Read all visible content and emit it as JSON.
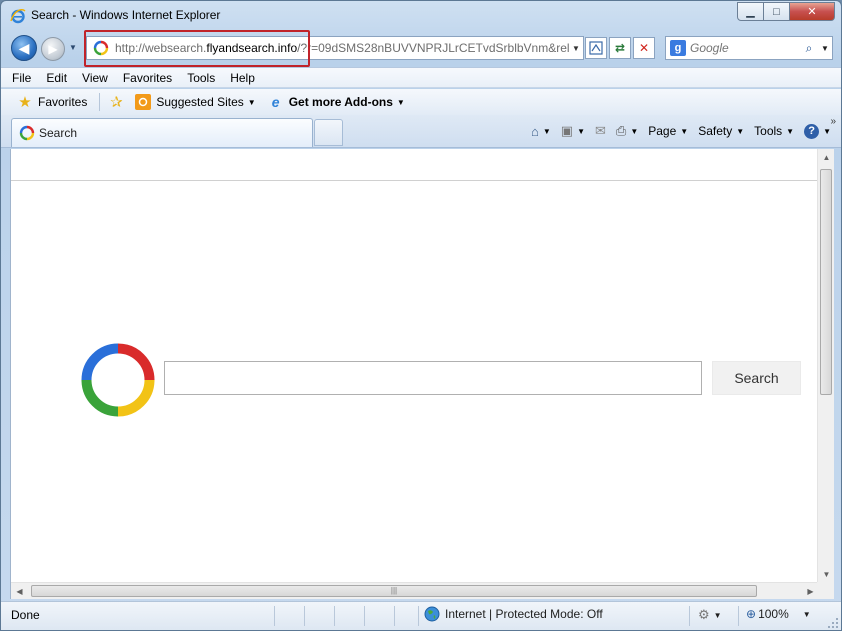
{
  "window": {
    "title": "Search - Windows Internet Explorer",
    "controls": {
      "minimize": "▁",
      "maximize": "□",
      "close": "✕"
    }
  },
  "navigation": {
    "url_prefix": "http://websearch.",
    "url_domain": "flyandsearch.info",
    "url_rest": "/?r=09dSMS28nBUVVNPRJLrCETvdSrblbVnm&relc",
    "search_engine_placeholder": "Google"
  },
  "menu": {
    "items": [
      "File",
      "Edit",
      "View",
      "Favorites",
      "Tools",
      "Help"
    ]
  },
  "favorites_bar": {
    "favorites_label": "Favorites",
    "suggested_sites_label": "Suggested Sites",
    "addons_label": "Get more Add-ons"
  },
  "tabs": {
    "active_tab_label": "Search"
  },
  "command_bar": {
    "page_label": "Page",
    "safety_label": "Safety",
    "tools_label": "Tools"
  },
  "page": {
    "search_input_value": "",
    "search_button_label": "Search",
    "logo_colors": [
      "#d92b2b",
      "#f2c316",
      "#3aa33a",
      "#2a6fd9"
    ]
  },
  "status_bar": {
    "status_text": "Done",
    "zone_text": "Internet | Protected Mode: Off",
    "zoom_text": "100%"
  }
}
